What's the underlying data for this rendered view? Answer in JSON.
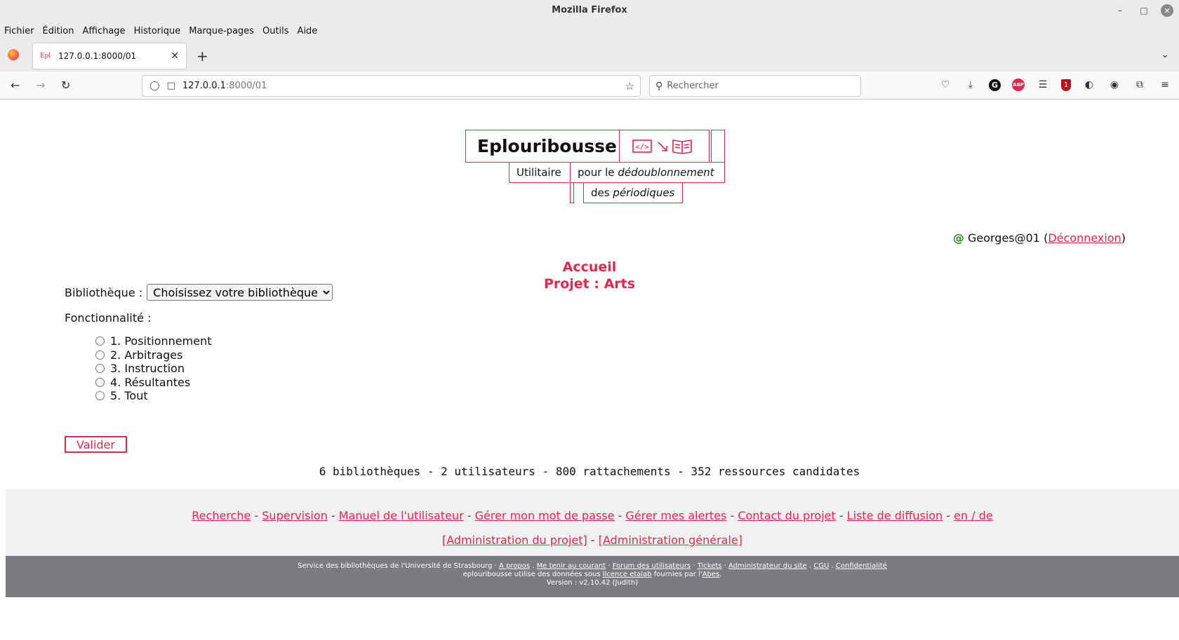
{
  "window": {
    "title": "Mozilla Firefox"
  },
  "menubar": {
    "items": [
      {
        "label": "Fichier"
      },
      {
        "label": "Édition"
      },
      {
        "label": "Affichage"
      },
      {
        "label": "Historique"
      },
      {
        "label": "Marque-pages"
      },
      {
        "label": "Outils"
      },
      {
        "label": "Aide"
      }
    ]
  },
  "tab": {
    "favicon_text": "Epl",
    "title": "127.0.0.1:8000/01"
  },
  "navbar": {
    "url_host": "127.0.0.1",
    "url_path": ":8000/01",
    "search_placeholder": "Rechercher"
  },
  "logo": {
    "title": "Eplouribousse",
    "sub1": "Utilitaire",
    "sub2_prefix": "pour le ",
    "sub2_italic": "dédoublonnement",
    "sub3_prefix": "des ",
    "sub3_italic": "périodiques",
    "accent": "#e8254b"
  },
  "user": {
    "at": "@",
    "name": "Georges@01",
    "open": " (",
    "logout": "Déconnexion",
    "close": ")"
  },
  "heading": {
    "line1": "Accueil",
    "line2": "Projet : Arts"
  },
  "form": {
    "library_label": "Bibliothèque :",
    "library_select": "Choisissez votre bibliothèque",
    "feature_label": "Fonctionnalité :",
    "options": [
      {
        "label": "1. Positionnement"
      },
      {
        "label": "2. Arbitrages"
      },
      {
        "label": "3. Instruction"
      },
      {
        "label": "4. Résultantes"
      },
      {
        "label": "5. Tout"
      }
    ],
    "submit": "Valider"
  },
  "stats": "6 bibliothèques - 2 utilisateurs - 800 rattachements - 352 ressources candidates",
  "links_footer": {
    "line1": [
      "Recherche",
      "Supervision",
      "Manuel de l'utilisateur",
      "Gérer mon mot de passe",
      "Gérer mes alertes",
      "Contact du projet",
      "Liste de diffusion",
      "en / de"
    ],
    "line2": [
      "[Administration du projet]",
      "[Administration générale]"
    ],
    "separator": " - "
  },
  "dark_footer": {
    "org": "Service des bibliothèques de l'Université de Strasbourg",
    "links": [
      "A propos",
      "Me tenir au courant",
      "Forum des utilisateurs",
      "Tickets",
      "Administrateur du site",
      "CGU",
      "Confidentialité"
    ],
    "line2_prefix": "eplouribousse utilise des données sous ",
    "licence": "licence etalab",
    "line2_mid": " fournies par l'",
    "abes": "Abes",
    "line2_end": ".",
    "version": "Version : v2.10.42 (Judith)"
  },
  "colors": {
    "accent": "#e8254b",
    "footer_dark": "#7c7c80",
    "footer_light": "#f1f1f1"
  }
}
